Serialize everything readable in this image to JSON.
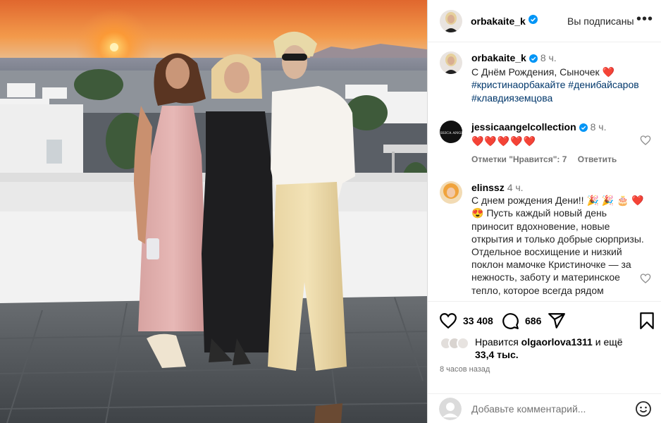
{
  "post": {
    "author": {
      "username": "orbakaite_k",
      "verified": true,
      "follow_status": "Вы подписаны"
    }
  },
  "caption": {
    "username": "orbakaite_k",
    "time": "8 ч.",
    "text": "С Днём Рождения, Сыночек",
    "emoji": "❤️",
    "hashtags": [
      "#кристинаорбакайте",
      "#денибайсаров",
      "#клавдияземцова"
    ]
  },
  "comments": [
    {
      "username": "jessicaangelcollection",
      "verified": true,
      "time": "8 ч.",
      "text": "❤️❤️❤️❤️❤️",
      "likes_label": "Отметки \"Нравится\": 7",
      "reply_label": "Ответить"
    },
    {
      "username": "elinssz",
      "time": "4 ч.",
      "text": "С днем рождения Дени!! 🎉 🎉 🎂 ❤️ 😍 Пусть каждый новый день приносит вдохновение, новые открытия и только добрые сюрпризы. Отдельное восхищение и низкий поклон мамочке Кристиночке — за нежность, заботу и материнское тепло, которое всегда рядом"
    }
  ],
  "actions": {
    "likes_count": "33 408",
    "comments_count": "686"
  },
  "liked_by": {
    "prefix": "Нравится ",
    "username": "olgaorlova1311",
    "middle": " и ещё",
    "others": "33,4 тыс."
  },
  "posted_ago": "8 часов назад",
  "comment_box": {
    "placeholder": "Добавьте комментарий..."
  },
  "colors": {
    "link": "#00376b",
    "verified": "#0095f6",
    "muted": "#737373",
    "heart": "#ed1c24"
  }
}
